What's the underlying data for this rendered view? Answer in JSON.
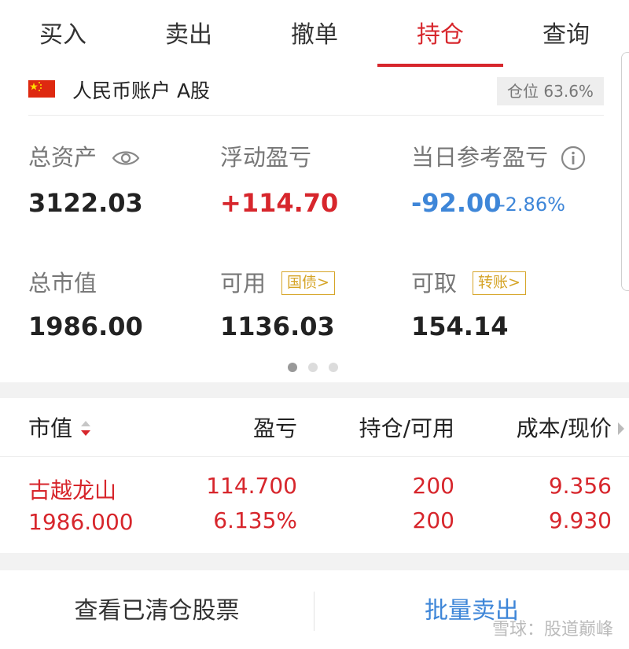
{
  "tabs": [
    {
      "label": "买入",
      "active": false
    },
    {
      "label": "卖出",
      "active": false
    },
    {
      "label": "撤单",
      "active": false
    },
    {
      "label": "持仓",
      "active": true
    },
    {
      "label": "查询",
      "active": false
    }
  ],
  "account": {
    "flag_icon": "china-flag-icon",
    "name": "人民币账户 A股",
    "position_label": "仓位 63.6%"
  },
  "stats": {
    "total_assets": {
      "label": "总资产",
      "value": "3122.03",
      "icon": "eye-icon"
    },
    "floating_pnl": {
      "label": "浮动盈亏",
      "value": "+114.70"
    },
    "daily_pnl": {
      "label": "当日参考盈亏",
      "value": "-92.00",
      "percent": "-2.86%",
      "icon": "info-icon"
    },
    "market_value": {
      "label": "总市值",
      "value": "1986.00"
    },
    "available": {
      "label": "可用",
      "value": "1136.03",
      "tag": "国债>"
    },
    "withdrawable": {
      "label": "可取",
      "value": "154.14",
      "tag": "转账>"
    }
  },
  "pager": {
    "count": 3,
    "active_index": 0
  },
  "table": {
    "headers": {
      "market_value": "市值",
      "pnl": "盈亏",
      "holdings": "持仓/可用",
      "cost_price": "成本/现价"
    },
    "rows": [
      {
        "name": "古越龙山",
        "market_value": "1986.000",
        "pnl": "114.700",
        "pnl_pct": "6.135%",
        "holding": "200",
        "available": "200",
        "cost": "9.356",
        "price": "9.930"
      }
    ]
  },
  "bottom": {
    "cleared_stocks": "查看已清仓股票",
    "batch_sell": "批量卖出",
    "watermark": "雪球：股道巅峰"
  },
  "colors": {
    "accent_red": "#d7262c",
    "blue": "#3e86d8",
    "gold": "#d6a528"
  }
}
